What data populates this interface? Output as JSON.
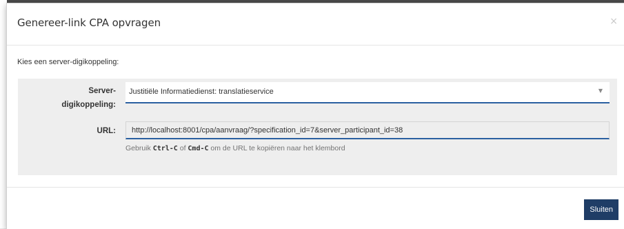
{
  "modal": {
    "title": "Genereer-link CPA opvragen",
    "close_icon": "×"
  },
  "body": {
    "intro": "Kies een server-digikoppeling:",
    "server_label_line1": "Server-",
    "server_label_line2": "digikoppeling:",
    "server_selected": "Justitiële Informatiedienst: translatieservice",
    "url_label": "URL:",
    "url_value": "http://localhost:8001/cpa/aanvraag/?specification_id=7&server_participant_id=38",
    "help_prefix": "Gebruik ",
    "help_key1": "Ctrl-C",
    "help_mid": " of ",
    "help_key2": "Cmd-C",
    "help_suffix": " om de URL te kopiëren naar het klembord"
  },
  "footer": {
    "close_button": "Sluiten"
  },
  "icons": {
    "close": "close-icon",
    "dropdown": "chevron-down-icon"
  },
  "colors": {
    "primary_button": "#1f3d66",
    "field_underline": "#2a5fa0",
    "panel_bg": "#eeeeee"
  }
}
